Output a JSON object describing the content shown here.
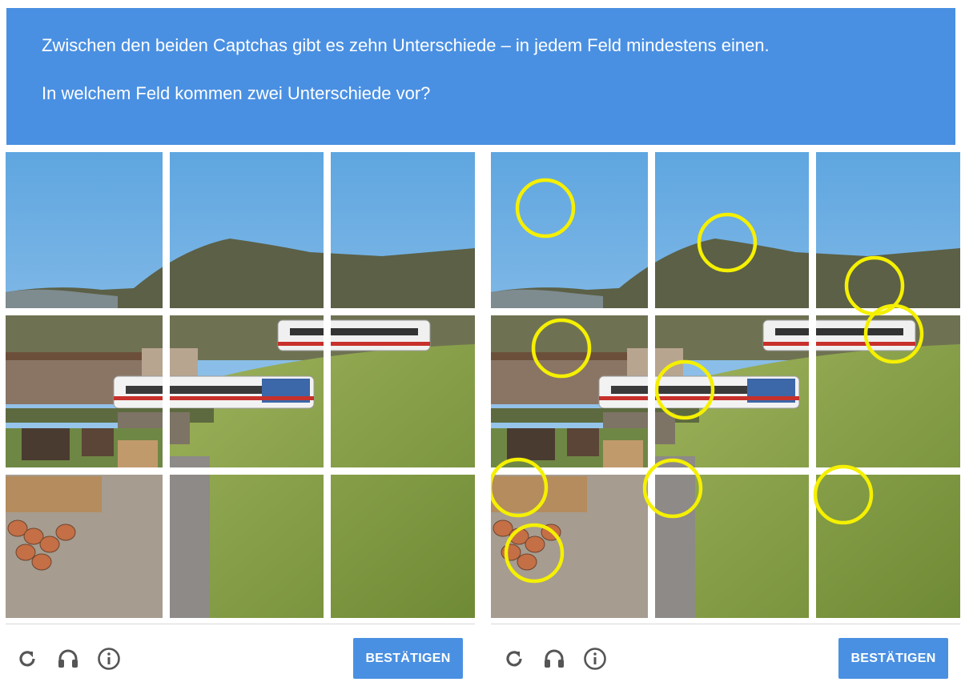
{
  "header": {
    "line1": "Zwischen den beiden Captchas gibt es zehn Unterschiede – in jedem Feld mindestens einen.",
    "line2": "In welchem Feld kommen zwei Unterschiede vor?"
  },
  "colors": {
    "header_bg": "#4a90e2",
    "button_bg": "#4a90e2",
    "marker": "#f5f000"
  },
  "left_captcha": {
    "tiles": [
      "tile-1",
      "tile-2",
      "tile-3",
      "tile-4",
      "tile-5",
      "tile-6",
      "tile-7",
      "tile-8",
      "tile-9"
    ],
    "controls": [
      "reload-icon",
      "headphones-icon",
      "info-icon"
    ],
    "confirm_label": "BESTÄTIGEN"
  },
  "right_captcha": {
    "tiles": [
      "tile-1",
      "tile-2",
      "tile-3",
      "tile-4",
      "tile-5",
      "tile-6",
      "tile-7",
      "tile-8",
      "tile-9"
    ],
    "difference_markers": 10,
    "controls": [
      "reload-icon",
      "headphones-icon",
      "info-icon"
    ],
    "confirm_label": "BESTÄTIGEN"
  }
}
